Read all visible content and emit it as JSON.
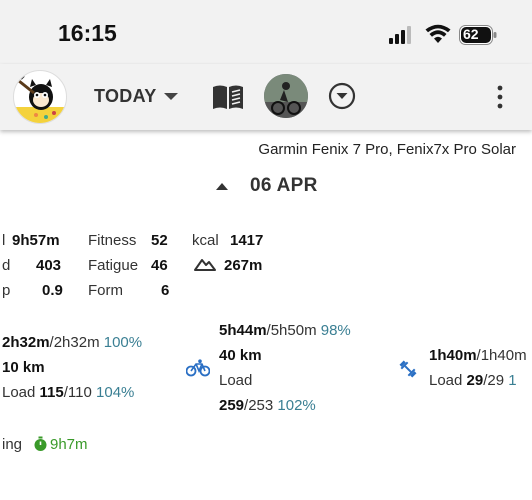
{
  "status_bar": {
    "time": "16:15",
    "battery": "62"
  },
  "app_bar": {
    "date_selector": "TODAY",
    "logo_icon": "cat-mascot-avatar",
    "book_icon": "book-open-icon",
    "athlete_icon": "athlete-photo-avatar",
    "circle_icon": "circle-chevron-down-icon",
    "menu_icon": "more-vertical-icon"
  },
  "device": "Garmin Fenix 7 Pro, Fenix7x Pro Solar",
  "date": "06 APR",
  "stats": {
    "col1": [
      {
        "label": "l",
        "value": "9h57m"
      },
      {
        "label": "d",
        "value": "403"
      },
      {
        "label": "p",
        "value": "0.9"
      }
    ],
    "col2": [
      {
        "label": "Fitness",
        "value": "52"
      },
      {
        "label": "Fatigue",
        "value": "46"
      },
      {
        "label": "Form",
        "value": "6"
      }
    ],
    "col3": [
      {
        "label": "kcal",
        "value": "1417"
      },
      {
        "label": "",
        "value": "267m"
      }
    ]
  },
  "sports": {
    "left": {
      "time": "2h32m",
      "time_target": "/2h32m",
      "time_pct": "100%",
      "distance": "10 km",
      "load_label": "Load",
      "load": "115",
      "load_target": "/110",
      "load_pct": "104%"
    },
    "center": {
      "time": "5h44m",
      "time_target": "/5h50m",
      "time_pct": "98%",
      "distance": "40 km",
      "load_label": "Load",
      "load": "259",
      "load_target": "/253",
      "load_pct": "102%"
    },
    "right": {
      "time": "1h40m",
      "time_target": "/1h40m",
      "load_label": "Load",
      "load": "29",
      "load_target": "/29",
      "load_pct": "1"
    }
  },
  "bottom": {
    "label": "ing",
    "value": "9h7m"
  },
  "colors": {
    "accent_pct": "#3a7f93",
    "green": "#3a9a2a",
    "bike_blue": "#2a6fc4"
  }
}
